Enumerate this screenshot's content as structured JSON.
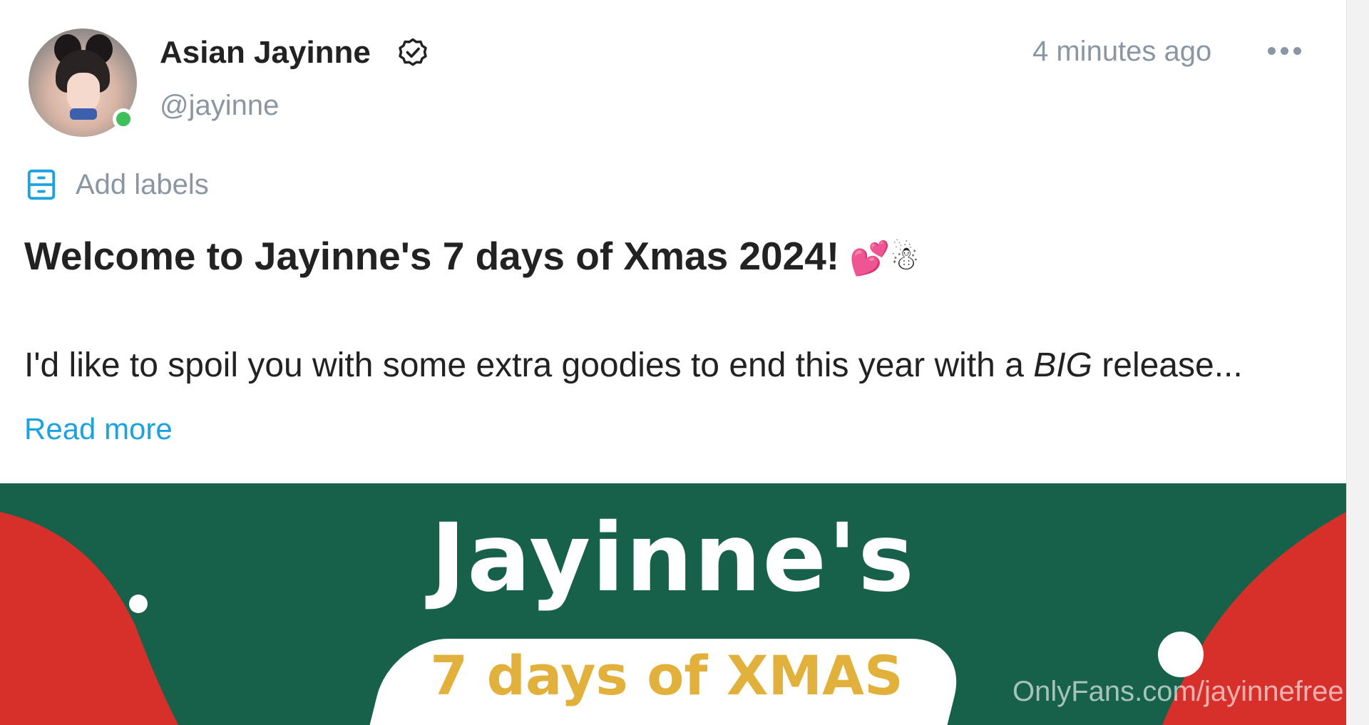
{
  "post": {
    "author": {
      "name": "Asian Jayinne",
      "handle": "@jayinne",
      "verified": true,
      "online": true
    },
    "time": "4 minutes ago",
    "labels_button": "Add labels",
    "title": "Welcome to Jayinne's 7 days of Xmas 2024!",
    "title_emoji": "💕☃",
    "body_start": "I'd like to spoil you with some extra goodies to end this year with a ",
    "body_emphasis": "BIG",
    "body_end": " release...",
    "read_more": "Read more"
  },
  "banner": {
    "title": "Jayinne's",
    "subtitle": "7 days of XMAS",
    "watermark": "OnlyFans.com/jayinnefree"
  },
  "icons": {
    "verified": "verified-badge-icon",
    "more": "more-options-icon",
    "labels": "label-tag-icon"
  },
  "colors": {
    "text": "#222222",
    "muted": "#8a96a3",
    "link": "#1aa3e0",
    "online": "#3fbf5a",
    "banner_green": "#17604a",
    "banner_red": "#d7302b",
    "banner_gold": "#e2b13c"
  }
}
